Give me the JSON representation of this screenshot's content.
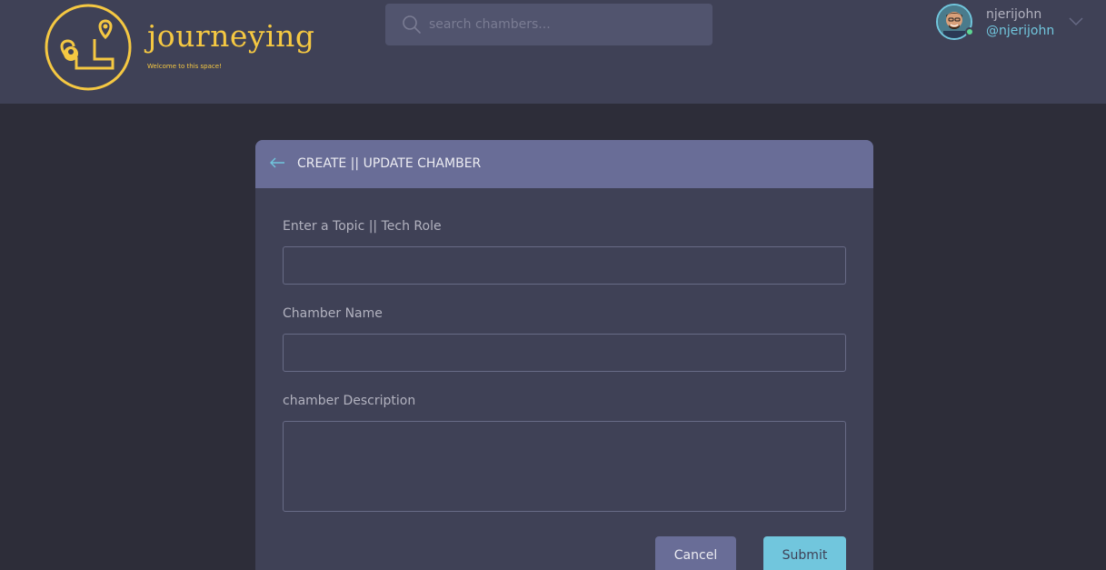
{
  "brand": {
    "name": "journeying",
    "tagline": "Welcome to this space!",
    "logo_icon": "map-pin-path-icon",
    "accent_color": "#f5c842"
  },
  "search": {
    "placeholder": "search chambers...",
    "value": "",
    "icon": "search-icon"
  },
  "user": {
    "name": "njerijohn",
    "handle": "@njerijohn",
    "status": "online",
    "menu_icon": "chevron-down-icon"
  },
  "form": {
    "back_icon": "arrow-left-icon",
    "title": "CREATE || UPDATE CHAMBER",
    "topic": {
      "label": "Enter a Topic || Tech Role",
      "value": ""
    },
    "name": {
      "label": "Chamber Name",
      "value": ""
    },
    "description": {
      "label": "chamber Description",
      "value": ""
    },
    "cancel_label": "Cancel",
    "submit_label": "Submit"
  },
  "colors": {
    "background": "#2d2d39",
    "surface": "#3f4156",
    "header_band": "#696d97",
    "highlight": "#71c6dd"
  }
}
